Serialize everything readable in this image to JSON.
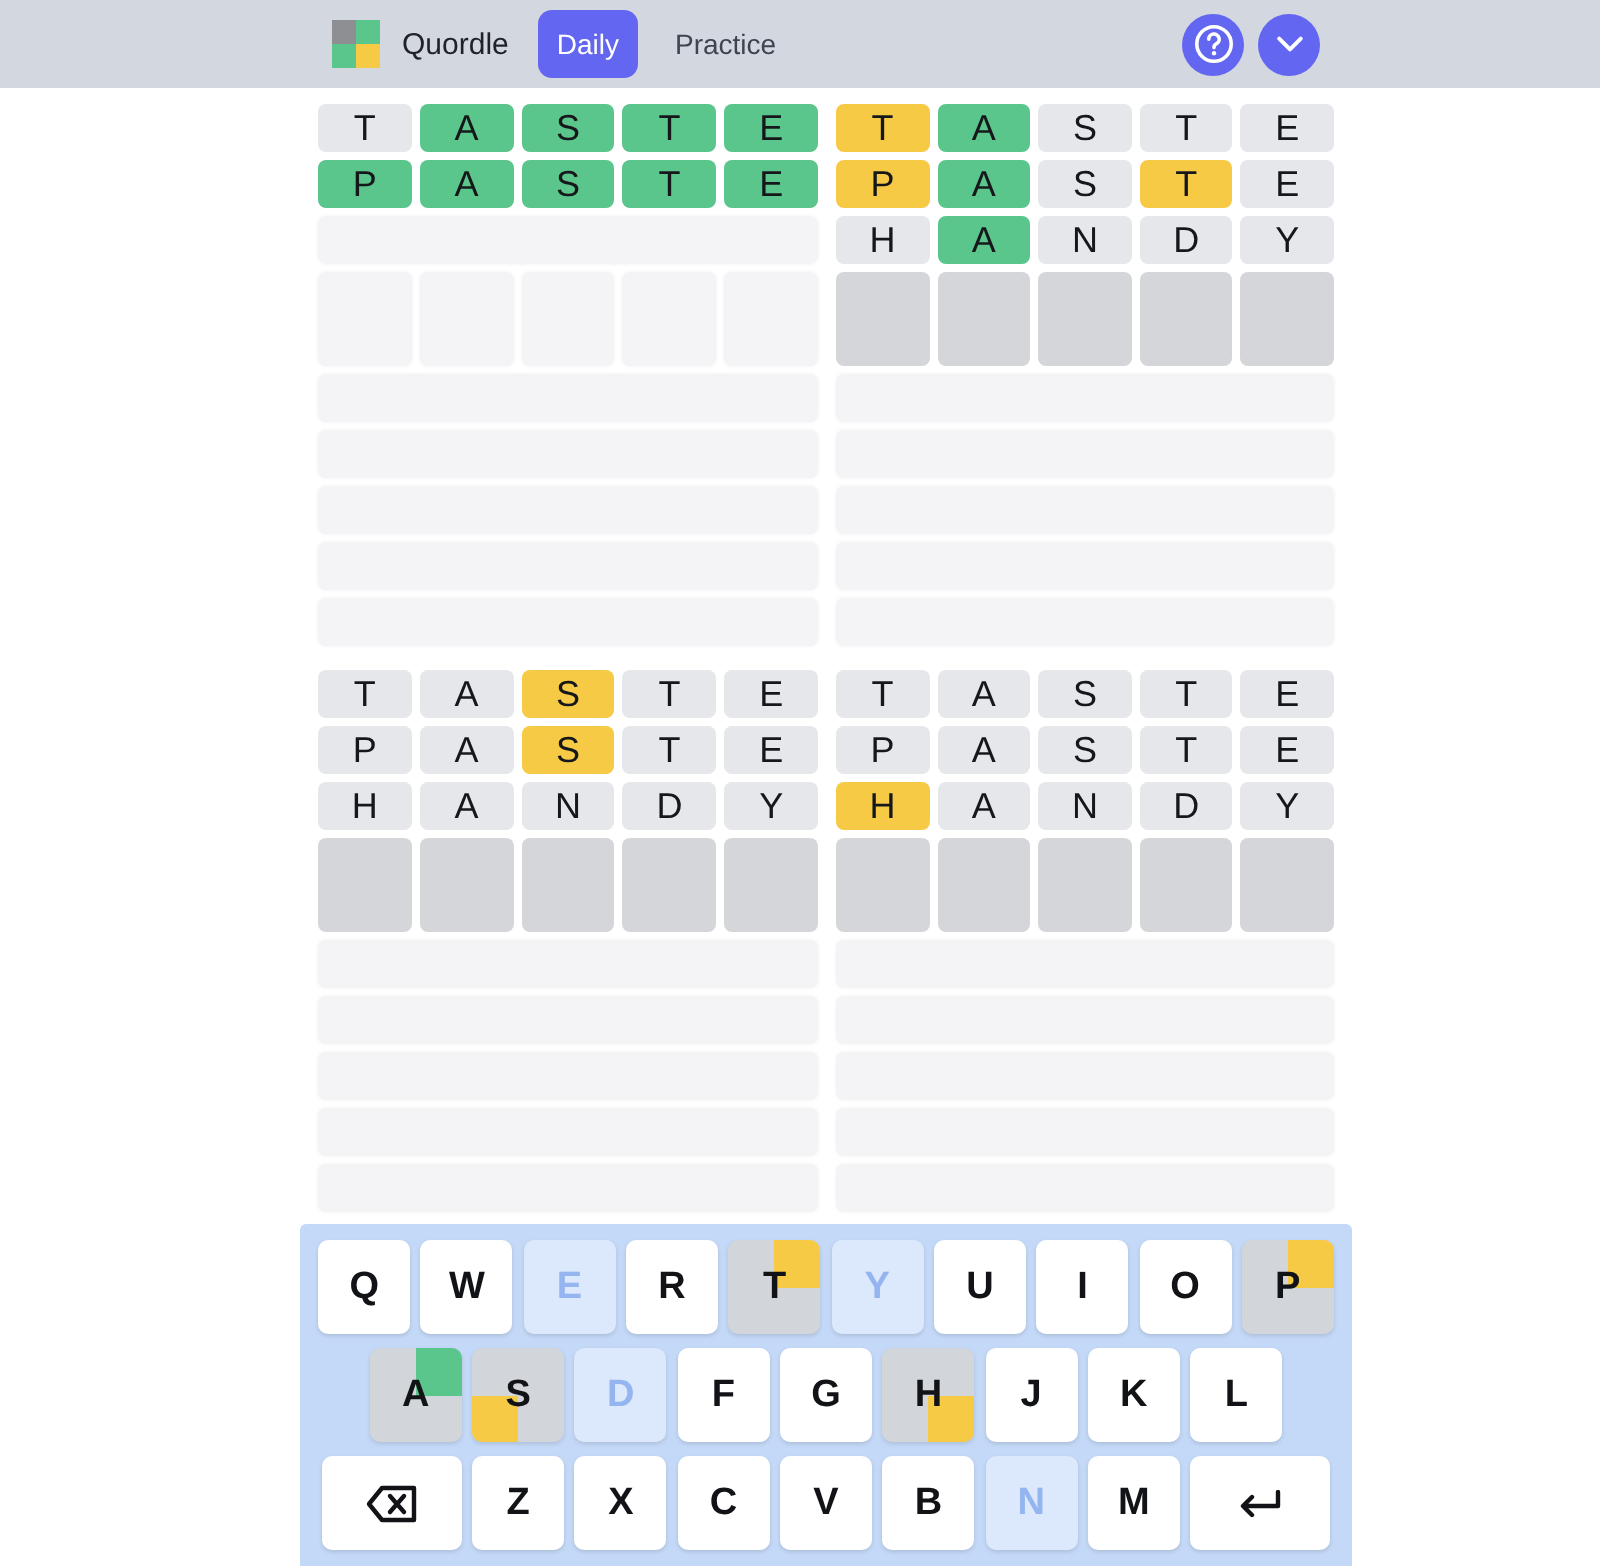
{
  "header": {
    "title": "Quordle",
    "tabs": [
      {
        "label": "Daily",
        "selected": true
      },
      {
        "label": "Practice",
        "selected": false
      }
    ]
  },
  "boards": [
    {
      "rows": [
        {
          "kind": "guess",
          "cells": [
            {
              "letter": "T",
              "kind": "absent"
            },
            {
              "letter": "A",
              "kind": "correct"
            },
            {
              "letter": "S",
              "kind": "correct"
            },
            {
              "letter": "T",
              "kind": "correct"
            },
            {
              "letter": "E",
              "kind": "correct"
            }
          ]
        },
        {
          "kind": "guess",
          "cells": [
            {
              "letter": "P",
              "kind": "correct"
            },
            {
              "letter": "A",
              "kind": "correct"
            },
            {
              "letter": "S",
              "kind": "correct"
            },
            {
              "letter": "T",
              "kind": "correct"
            },
            {
              "letter": "E",
              "kind": "correct"
            }
          ]
        },
        {
          "kind": "empty"
        },
        {
          "kind": "input",
          "active": false
        },
        {
          "kind": "empty"
        },
        {
          "kind": "empty"
        },
        {
          "kind": "empty"
        },
        {
          "kind": "empty"
        },
        {
          "kind": "empty"
        }
      ]
    },
    {
      "rows": [
        {
          "kind": "guess",
          "cells": [
            {
              "letter": "T",
              "kind": "present"
            },
            {
              "letter": "A",
              "kind": "correct"
            },
            {
              "letter": "S",
              "kind": "absent"
            },
            {
              "letter": "T",
              "kind": "absent"
            },
            {
              "letter": "E",
              "kind": "absent"
            }
          ]
        },
        {
          "kind": "guess",
          "cells": [
            {
              "letter": "P",
              "kind": "present"
            },
            {
              "letter": "A",
              "kind": "correct"
            },
            {
              "letter": "S",
              "kind": "absent"
            },
            {
              "letter": "T",
              "kind": "present"
            },
            {
              "letter": "E",
              "kind": "absent"
            }
          ]
        },
        {
          "kind": "guess",
          "cells": [
            {
              "letter": "H",
              "kind": "absent"
            },
            {
              "letter": "A",
              "kind": "correct"
            },
            {
              "letter": "N",
              "kind": "absent"
            },
            {
              "letter": "D",
              "kind": "absent"
            },
            {
              "letter": "Y",
              "kind": "absent"
            }
          ]
        },
        {
          "kind": "input",
          "active": true
        },
        {
          "kind": "empty"
        },
        {
          "kind": "empty"
        },
        {
          "kind": "empty"
        },
        {
          "kind": "empty"
        },
        {
          "kind": "empty"
        }
      ]
    },
    {
      "rows": [
        {
          "kind": "guess",
          "cells": [
            {
              "letter": "T",
              "kind": "absent"
            },
            {
              "letter": "A",
              "kind": "absent"
            },
            {
              "letter": "S",
              "kind": "present"
            },
            {
              "letter": "T",
              "kind": "absent"
            },
            {
              "letter": "E",
              "kind": "absent"
            }
          ]
        },
        {
          "kind": "guess",
          "cells": [
            {
              "letter": "P",
              "kind": "absent"
            },
            {
              "letter": "A",
              "kind": "absent"
            },
            {
              "letter": "S",
              "kind": "present"
            },
            {
              "letter": "T",
              "kind": "absent"
            },
            {
              "letter": "E",
              "kind": "absent"
            }
          ]
        },
        {
          "kind": "guess",
          "cells": [
            {
              "letter": "H",
              "kind": "absent"
            },
            {
              "letter": "A",
              "kind": "absent"
            },
            {
              "letter": "N",
              "kind": "absent"
            },
            {
              "letter": "D",
              "kind": "absent"
            },
            {
              "letter": "Y",
              "kind": "absent"
            }
          ]
        },
        {
          "kind": "input",
          "active": true
        },
        {
          "kind": "empty"
        },
        {
          "kind": "empty"
        },
        {
          "kind": "empty"
        },
        {
          "kind": "empty"
        },
        {
          "kind": "empty"
        }
      ]
    },
    {
      "rows": [
        {
          "kind": "guess",
          "cells": [
            {
              "letter": "T",
              "kind": "absent"
            },
            {
              "letter": "A",
              "kind": "absent"
            },
            {
              "letter": "S",
              "kind": "absent"
            },
            {
              "letter": "T",
              "kind": "absent"
            },
            {
              "letter": "E",
              "kind": "absent"
            }
          ]
        },
        {
          "kind": "guess",
          "cells": [
            {
              "letter": "P",
              "kind": "absent"
            },
            {
              "letter": "A",
              "kind": "absent"
            },
            {
              "letter": "S",
              "kind": "absent"
            },
            {
              "letter": "T",
              "kind": "absent"
            },
            {
              "letter": "E",
              "kind": "absent"
            }
          ]
        },
        {
          "kind": "guess",
          "cells": [
            {
              "letter": "H",
              "kind": "present"
            },
            {
              "letter": "A",
              "kind": "absent"
            },
            {
              "letter": "N",
              "kind": "absent"
            },
            {
              "letter": "D",
              "kind": "absent"
            },
            {
              "letter": "Y",
              "kind": "absent"
            }
          ]
        },
        {
          "kind": "input",
          "active": true
        },
        {
          "kind": "empty"
        },
        {
          "kind": "empty"
        },
        {
          "kind": "empty"
        },
        {
          "kind": "empty"
        },
        {
          "kind": "empty"
        }
      ]
    }
  ],
  "keyboard": {
    "rows": [
      {
        "keys": [
          {
            "kind": "unused",
            "label": "Q"
          },
          {
            "kind": "unused",
            "label": "W"
          },
          {
            "kind": "absent",
            "label": "E"
          },
          {
            "kind": "unused",
            "label": "R"
          },
          {
            "kind": "used",
            "label": "T",
            "quadrants": [
              {
                "kind": "none"
              },
              {
                "kind": "present"
              },
              {
                "kind": "none"
              },
              {
                "kind": "none"
              }
            ]
          },
          {
            "kind": "absent",
            "label": "Y"
          },
          {
            "kind": "unused",
            "label": "U"
          },
          {
            "kind": "unused",
            "label": "I"
          },
          {
            "kind": "unused",
            "label": "O"
          },
          {
            "kind": "used",
            "label": "P",
            "quadrants": [
              {
                "kind": "none"
              },
              {
                "kind": "present"
              },
              {
                "kind": "none"
              },
              {
                "kind": "none"
              }
            ]
          }
        ]
      },
      {
        "keys": [
          {
            "kind": "used",
            "label": "A",
            "quadrants": [
              {
                "kind": "none"
              },
              {
                "kind": "correct"
              },
              {
                "kind": "none"
              },
              {
                "kind": "none"
              }
            ]
          },
          {
            "kind": "used",
            "label": "S",
            "quadrants": [
              {
                "kind": "none"
              },
              {
                "kind": "none"
              },
              {
                "kind": "present"
              },
              {
                "kind": "none"
              }
            ]
          },
          {
            "kind": "absent",
            "label": "D"
          },
          {
            "kind": "unused",
            "label": "F"
          },
          {
            "kind": "unused",
            "label": "G"
          },
          {
            "kind": "used",
            "label": "H",
            "quadrants": [
              {
                "kind": "none"
              },
              {
                "kind": "none"
              },
              {
                "kind": "none"
              },
              {
                "kind": "present"
              }
            ]
          },
          {
            "kind": "unused",
            "label": "J"
          },
          {
            "kind": "unused",
            "label": "K"
          },
          {
            "kind": "unused",
            "label": "L"
          }
        ]
      },
      {
        "keys": [
          {
            "kind": "backspace"
          },
          {
            "kind": "unused",
            "label": "Z"
          },
          {
            "kind": "unused",
            "label": "X"
          },
          {
            "kind": "unused",
            "label": "C"
          },
          {
            "kind": "unused",
            "label": "V"
          },
          {
            "kind": "unused",
            "label": "B"
          },
          {
            "kind": "absent",
            "label": "N"
          },
          {
            "kind": "unused",
            "label": "M"
          },
          {
            "kind": "enter"
          }
        ]
      }
    ]
  }
}
